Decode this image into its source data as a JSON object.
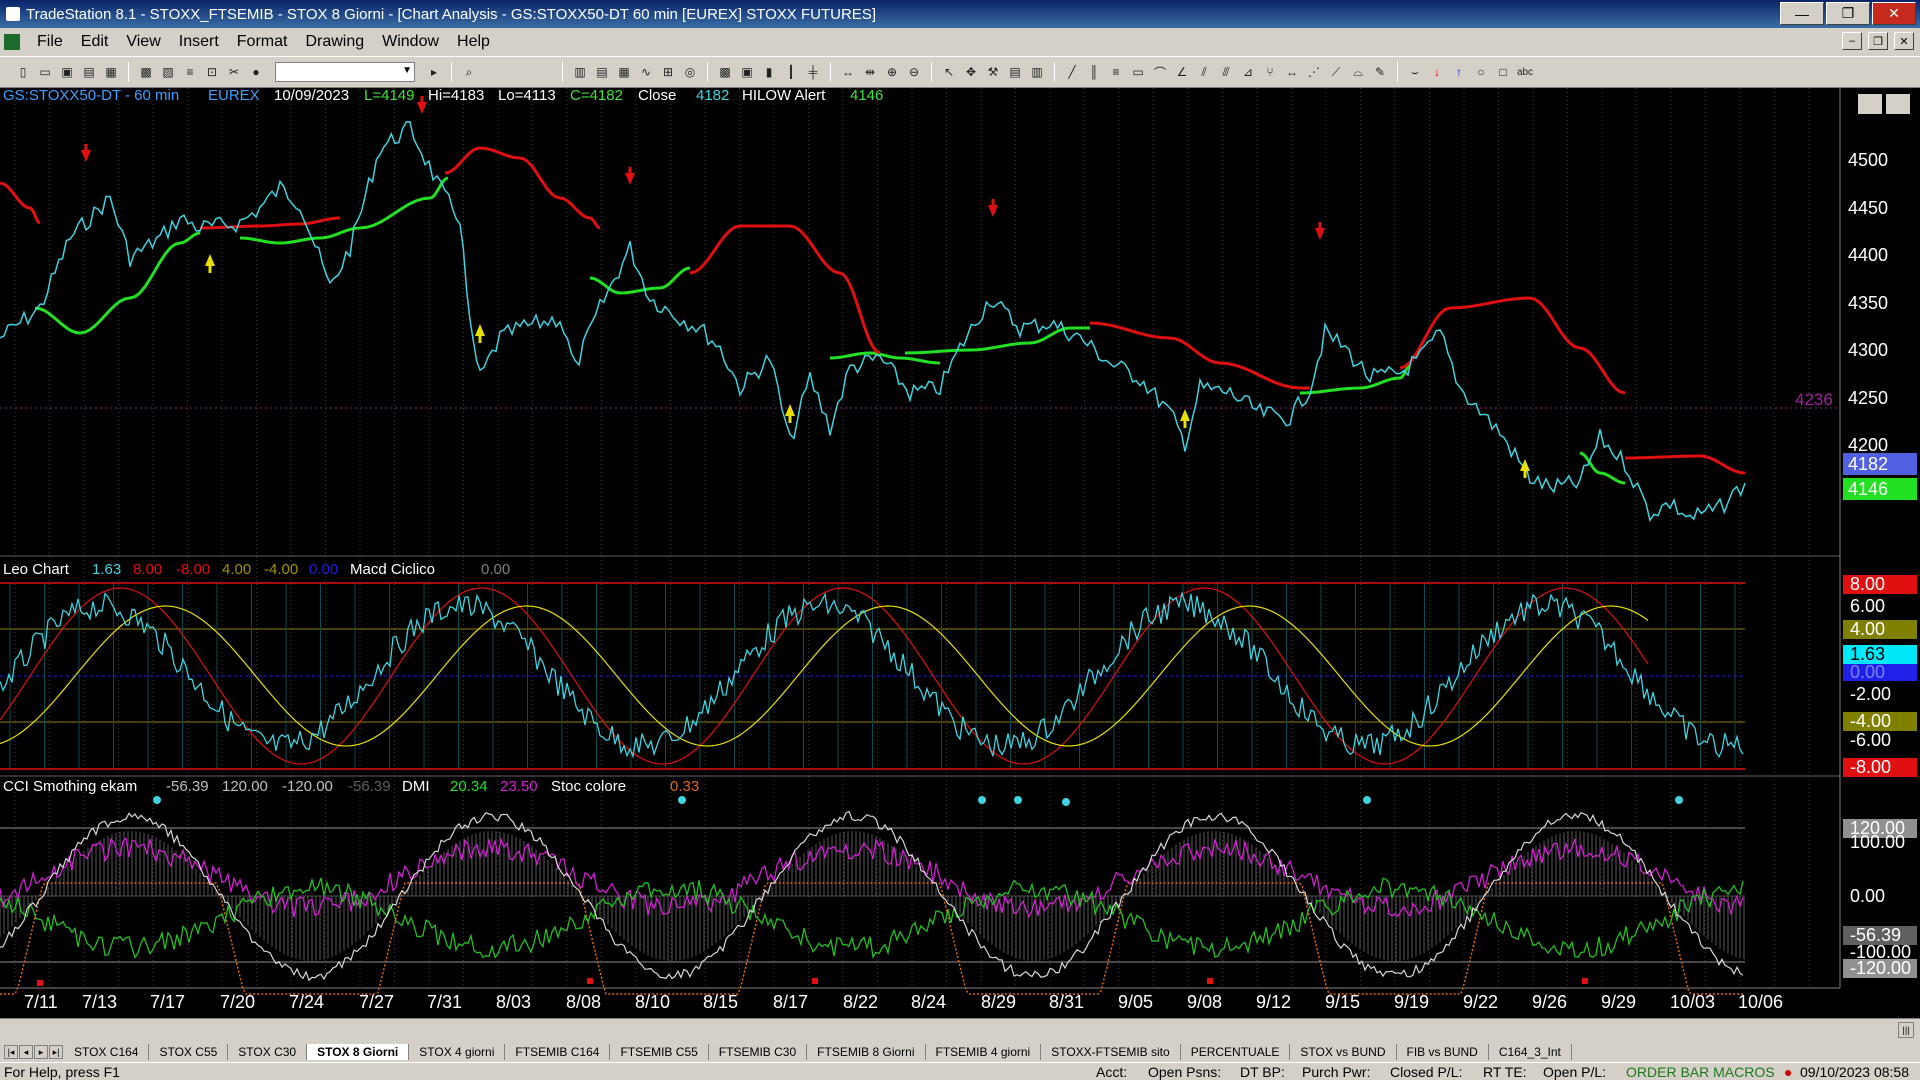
{
  "window": {
    "title": "TradeStation 8.1 - STOXX_FTSEMIB - STOX  8 Giorni - [Chart Analysis - GS:STOXX50-DT  60 min  [EUREX] STOXX FUTURES]",
    "min": "—",
    "max": "❐",
    "close": "✕"
  },
  "menu": [
    "File",
    "Edit",
    "View",
    "Insert",
    "Format",
    "Drawing",
    "Window",
    "Help"
  ],
  "chart": {
    "header": {
      "symbol": "GS:STOXX50-DT - 60 min",
      "exchange": "EUREX",
      "date": "10/09/2023",
      "L": "L=4149",
      "Hi": "Hi=4183",
      "Lo": "Lo=4113",
      "C": "C=4182",
      "close_label": "Close",
      "close_val": "4182",
      "hilow_label": "HILOW Alert",
      "hilow_val": "4146"
    },
    "price_axis": [
      "4500",
      "4450",
      "4400",
      "4350",
      "4300",
      "4250",
      "4200"
    ],
    "price_marker": "4236",
    "last_close": "4182",
    "last_alert": "4146",
    "leo": {
      "label": "Leo Chart",
      "v1": "1.63",
      "v2": "8.00",
      "v3": "-8.00",
      "v4": "4.00",
      "v5": "-4.00",
      "v6": "0.00",
      "macd_label": "Macd Ciclico",
      "macd_val": "0.00",
      "axis": [
        "8.00",
        "6.00",
        "4.00",
        "1.63",
        "0.00",
        "-2.00",
        "-4.00",
        "-6.00",
        "-8.00"
      ]
    },
    "cci": {
      "label": "CCI Smothing ekam",
      "v1": "-56.39",
      "v2": "120.00",
      "v3": "-120.00",
      "v4": "-56.39",
      "dmi_label": "DMI",
      "dmi1": "20.34",
      "dmi2": "23.50",
      "stoc_label": "Stoc colore",
      "stoc_val": "0.33",
      "axis": [
        "120.00",
        "100.00",
        "0.00",
        "-56.39",
        "-100.00",
        "-120.00"
      ]
    },
    "dates": [
      "7/11",
      "7/13",
      "7/17",
      "7/20",
      "7/24",
      "7/27",
      "7/31",
      "8/03",
      "8/08",
      "8/10",
      "8/15",
      "8/17",
      "8/22",
      "8/24",
      "8/29",
      "8/31",
      "9/05",
      "9/08",
      "9/12",
      "9/15",
      "9/19",
      "9/22",
      "9/26",
      "9/29",
      "10/03",
      "10/06"
    ]
  },
  "tabs": [
    "STOX C164",
    "STOX C55",
    "STOX  C30",
    "STOX  8 Giorni",
    "STOX 4 giorni",
    "FTSEMIB C164",
    "FTSEMIB C55",
    "FTSEMIB C30",
    "FTSEMIB  8 Giorni",
    "FTSEMIB  4 giorni",
    "STOXX-FTSEMIB sito",
    "PERCENTUALE",
    "STOX vs BUND",
    "FIB vs BUND",
    "C164_3_Int"
  ],
  "status": {
    "help": "For Help, press F1",
    "acct": "Acct:",
    "open_psns": "Open Psns:",
    "dt_bp": "DT BP:",
    "purch": "Purch Pwr:",
    "closed_pl": "Closed P/L:",
    "rt_te": "RT TE:",
    "open_pl": "Open P/L:",
    "macros": "ORDER BAR  MACROS",
    "clock": "09/10/2023 08:58"
  },
  "colors": {
    "cyan": "#3fd3e0",
    "red": "#e01010",
    "green": "#22e022",
    "yellow": "#e8e000",
    "magenta": "#d020d0",
    "orange": "#e06a10"
  }
}
